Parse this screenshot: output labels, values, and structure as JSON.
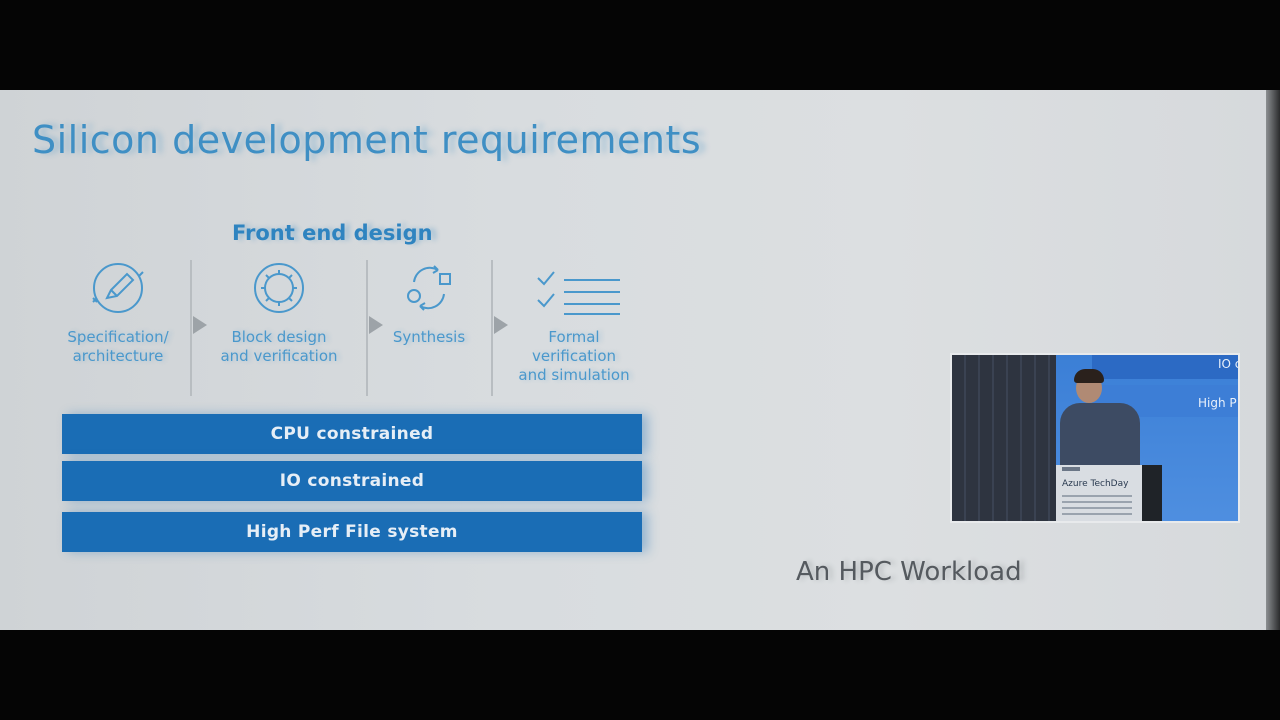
{
  "slide": {
    "title": "Silicon development requirements",
    "section_heading": "Front end design",
    "steps": [
      {
        "label": "Specification/\narchitecture",
        "icon": "pencil-circle-icon"
      },
      {
        "label": "Block design\nand verification",
        "icon": "gear-circle-icon"
      },
      {
        "label": "Synthesis",
        "icon": "cycle-arrows-icon"
      },
      {
        "label": "Formal\nverification\nand simulation",
        "icon": "checklist-icon"
      }
    ],
    "bars": [
      "CPU constrained",
      "IO constrained",
      "High Perf File system"
    ],
    "caption": "An HPC Workload",
    "accent_color": "#2f84c0",
    "bar_color": "#1a6db5"
  },
  "video_inset": {
    "screen_text_1": "IO c",
    "screen_text_2": "High P",
    "podium_text": "Azure TechDay"
  }
}
